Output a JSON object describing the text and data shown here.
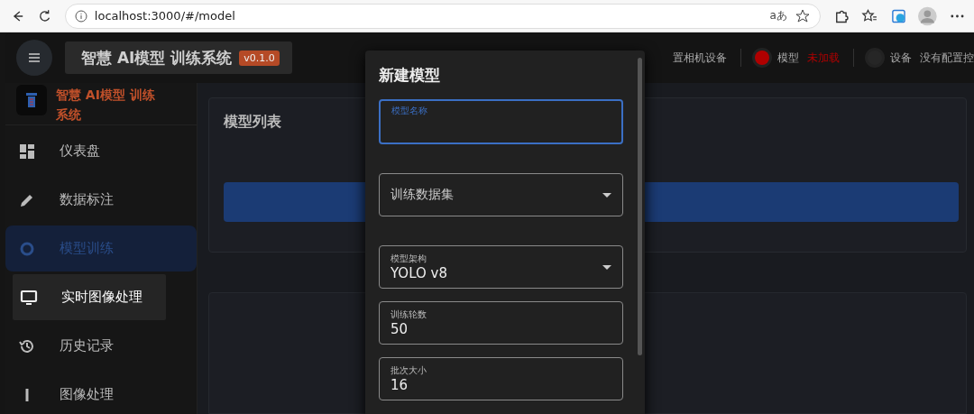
{
  "browser": {
    "url": "localhost:3000/#/model",
    "translate": "aあ"
  },
  "header": {
    "title": "智慧 AI模型 训练系统",
    "version": "v0.1.0",
    "status": [
      {
        "kind": "text",
        "value": "置相机设备"
      },
      {
        "kind": "dot",
        "label": "模型",
        "value": "未加载",
        "color": "#b00000"
      },
      {
        "kind": "dot",
        "label": "设备",
        "value": "没有配置控",
        "color": "#262626"
      }
    ]
  },
  "sidebar": {
    "brand": "智慧 AI模型 训练系统",
    "items": [
      {
        "label": "仪表盘",
        "selected": false,
        "hovered": false
      },
      {
        "label": "数据标注",
        "selected": false,
        "hovered": false
      },
      {
        "label": "模型训练",
        "selected": true,
        "hovered": false
      },
      {
        "label": "实时图像处理",
        "selected": false,
        "hovered": true
      },
      {
        "label": "历史记录",
        "selected": false,
        "hovered": false
      },
      {
        "label": "图像处理",
        "selected": false,
        "hovered": false
      }
    ]
  },
  "main": {
    "card_title": "模型列表"
  },
  "dialog": {
    "title": "新建模型",
    "fields": [
      {
        "kind": "text",
        "label": "模型名称",
        "focused": true
      },
      {
        "kind": "select",
        "placeholder": "训练数据集",
        "focused": false
      },
      {
        "kind": "select",
        "label": "模型架构",
        "value": "YOLO v8",
        "focused": false
      },
      {
        "kind": "text",
        "label": "训练轮数",
        "value": "50",
        "focused": false
      },
      {
        "kind": "text",
        "label": "批次大小",
        "value": "16",
        "focused": false
      }
    ]
  }
}
